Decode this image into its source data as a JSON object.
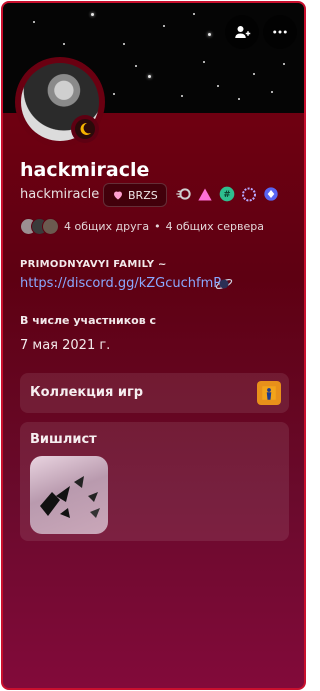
{
  "profile": {
    "display_name": "hackmiracle",
    "username": "hackmiracle",
    "tag_label": "BRZS",
    "mutual_friends": "4 общих друга",
    "mutual_dot": "•",
    "mutual_servers": "4 общих сервера"
  },
  "about": {
    "title": "PRIMODNYAVYI FAMILY ~",
    "link": "https://discord.gg/kZGcuchfmR"
  },
  "member_since": {
    "label": "В числе участников с",
    "date": "7 мая 2021 г."
  },
  "games": {
    "title": "Коллекция игр"
  },
  "wishlist": {
    "title": "Вишлист"
  },
  "colors": {
    "accent": "#c8102e",
    "link": "#8aa8ff"
  },
  "icons": [
    "add-friend-icon",
    "more-icon",
    "moon-status-icon",
    "heart-icon",
    "speed-badge-icon",
    "triangle-badge-icon",
    "hashtag-badge-icon",
    "ring-badge-icon",
    "diamond-badge-icon",
    "planet-emoji-icon",
    "counter-strike-icon"
  ]
}
